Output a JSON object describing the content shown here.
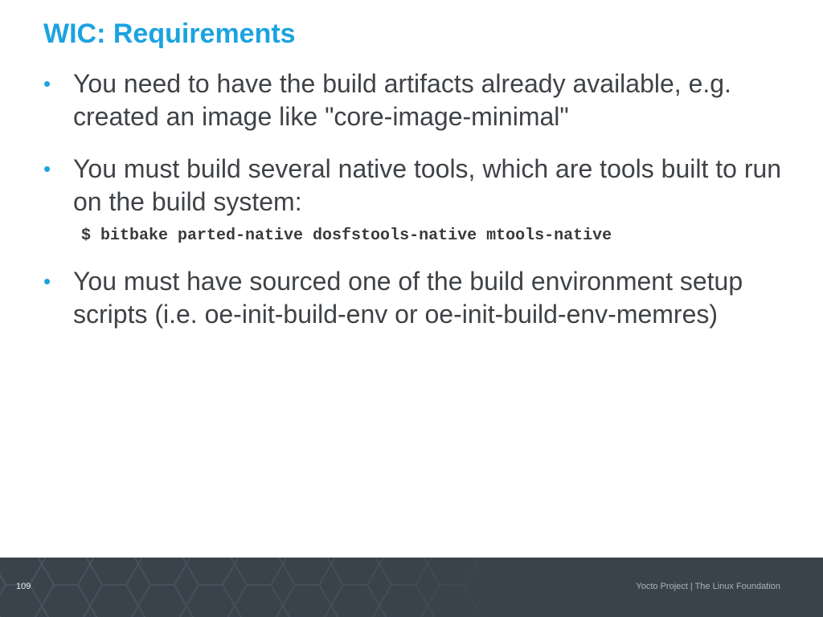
{
  "slide": {
    "title": "WIC: Requirements",
    "bullets": [
      {
        "text": "You need to have the build artifacts already available, e.g. created an image like \"core-image-minimal\"",
        "code": ""
      },
      {
        "text": "You must build several native tools, which are tools built to run on the build system:",
        "code": "$ bitbake parted-native dosfstools-native mtools-native"
      },
      {
        "text": "You must have sourced one of the build environment setup scripts (i.e. oe-init-build-env or oe-init-build-env-memres)",
        "code": ""
      }
    ],
    "bullet_glyph": "•"
  },
  "footer": {
    "page_number": "109",
    "credit": "Yocto Project | The Linux Foundation"
  },
  "colors": {
    "accent": "#1ba3e0",
    "body_text": "#3f4347",
    "footer_bg": "#3a424b"
  }
}
